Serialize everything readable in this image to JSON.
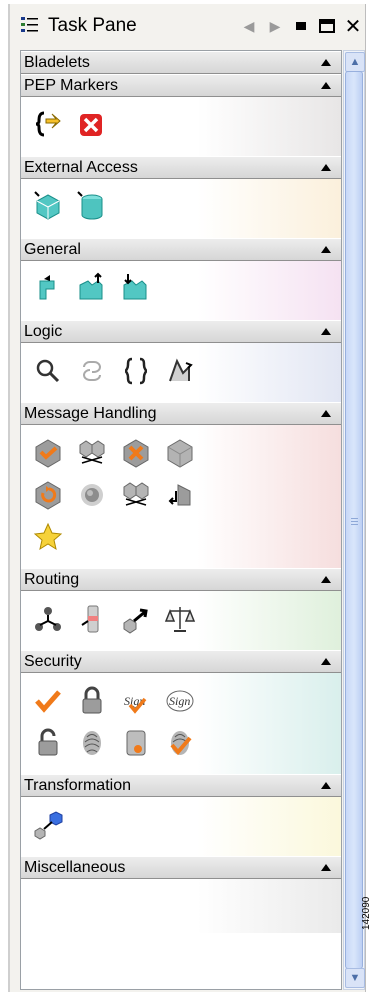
{
  "pane": {
    "title": "Task Pane"
  },
  "title_icons": [
    "task-list-icon",
    "back-arrow-icon",
    "forward-arrow-icon",
    "minimize-icon",
    "maximize-icon",
    "close-icon"
  ],
  "bladelets": {
    "label": "Bladelets"
  },
  "sections": [
    {
      "key": "pep",
      "label": "PEP Markers",
      "tint": "#e8e6e6",
      "icons": [
        [
          "pep-start-marker-icon",
          "pep-end-marker-icon"
        ]
      ]
    },
    {
      "key": "external",
      "label": "External Access",
      "tint": "#fbf0dc",
      "icons": [
        [
          "network-access-icon",
          "database-access-icon"
        ]
      ]
    },
    {
      "key": "general",
      "label": "General",
      "tint": "#f5e2f2",
      "icons": [
        [
          "general-transform-icon",
          "general-output-icon",
          "general-input-icon"
        ]
      ]
    },
    {
      "key": "logic",
      "label": "Logic",
      "tint": "#e2e6f3",
      "icons": [
        [
          "search-logic-icon",
          "loop-icon",
          "braces-icon",
          "branch-icon"
        ]
      ]
    },
    {
      "key": "message",
      "label": "Message Handling",
      "tint": "#f6dede",
      "icons": [
        [
          "validate-message-icon",
          "replicate-message-icon",
          "reject-message-icon",
          "cube-icon"
        ],
        [
          "retry-message-icon",
          "sphere-icon",
          "route-copy-icon",
          "return-message-icon"
        ],
        [
          "favorite-star-icon"
        ]
      ]
    },
    {
      "key": "routing",
      "label": "Routing",
      "tint": "#dff0dc",
      "icons": [
        [
          "route-split-icon",
          "route-filter-icon",
          "route-forward-icon",
          "load-balance-icon"
        ]
      ]
    },
    {
      "key": "security",
      "label": "Security",
      "tint": "#d9efec",
      "icons": [
        [
          "verify-check-icon",
          "lock-icon",
          "sign-verify-icon",
          "sign-icon"
        ],
        [
          "unlock-icon",
          "fingerprint-icon",
          "certificate-icon",
          "fingerprint-verify-icon"
        ]
      ]
    },
    {
      "key": "transformation",
      "label": "Transformation",
      "tint": "#fbf8dc",
      "icons": [
        [
          "transform-icon"
        ]
      ]
    },
    {
      "key": "misc",
      "label": "Miscellaneous",
      "tint": "#eaeaea",
      "icons": []
    }
  ],
  "figure_id": "142090"
}
